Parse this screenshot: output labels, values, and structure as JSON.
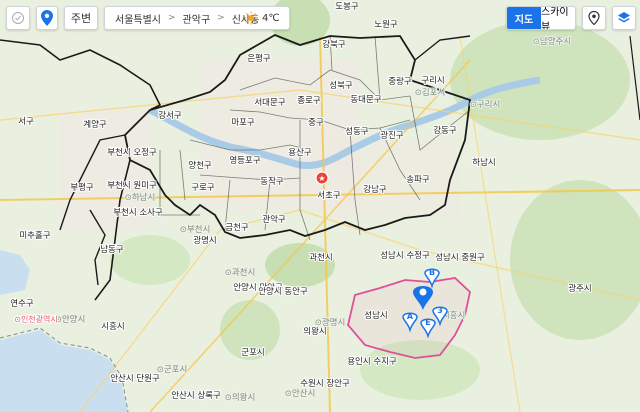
{
  "toolbar": {
    "home_label": "주변",
    "breadcrumb": [
      "서울특별시",
      "관악구",
      "신사동"
    ],
    "weather_temp": "4℃",
    "map_type_options": [
      "지도",
      "스카이뷰"
    ],
    "map_type_selected": "지도"
  },
  "map": {
    "district_labels": [
      "도봉구",
      "노원구",
      "강북구",
      "은평구",
      "성북구",
      "중랑구",
      "구리시",
      "서대문구",
      "종로구",
      "동대문구",
      "강서구",
      "마포구",
      "중구",
      "성동구",
      "광진구",
      "강동구",
      "양천구",
      "영등포구",
      "용산구",
      "동작구",
      "구로구",
      "서초구",
      "강남구",
      "송파구",
      "하남시",
      "금천구",
      "관악구",
      "계양구",
      "부천시 오정구",
      "부천시 원미구",
      "부천시 소사구",
      "부평구",
      "서구",
      "남동구",
      "미추홀구",
      "광명시",
      "과천시",
      "성남시 수정구",
      "성남시 중원구",
      "광주시",
      "안양시 만안구",
      "안양시 동안구",
      "의왕시",
      "군포시",
      "성남시",
      "용인시 수지구",
      "수원시 장안구",
      "안산시 단원구",
      "안산시 상록구",
      "시흥시",
      "연수구"
    ],
    "faint_labels": [
      "남양주시",
      "김포시",
      "구리시",
      "하남시",
      "광명시",
      "과천시",
      "안양시",
      "시흥시",
      "의왕시",
      "군포시",
      "안산시",
      "부천시",
      "인천광역시"
    ],
    "markers": [
      "A",
      "B",
      "E",
      "3"
    ]
  }
}
